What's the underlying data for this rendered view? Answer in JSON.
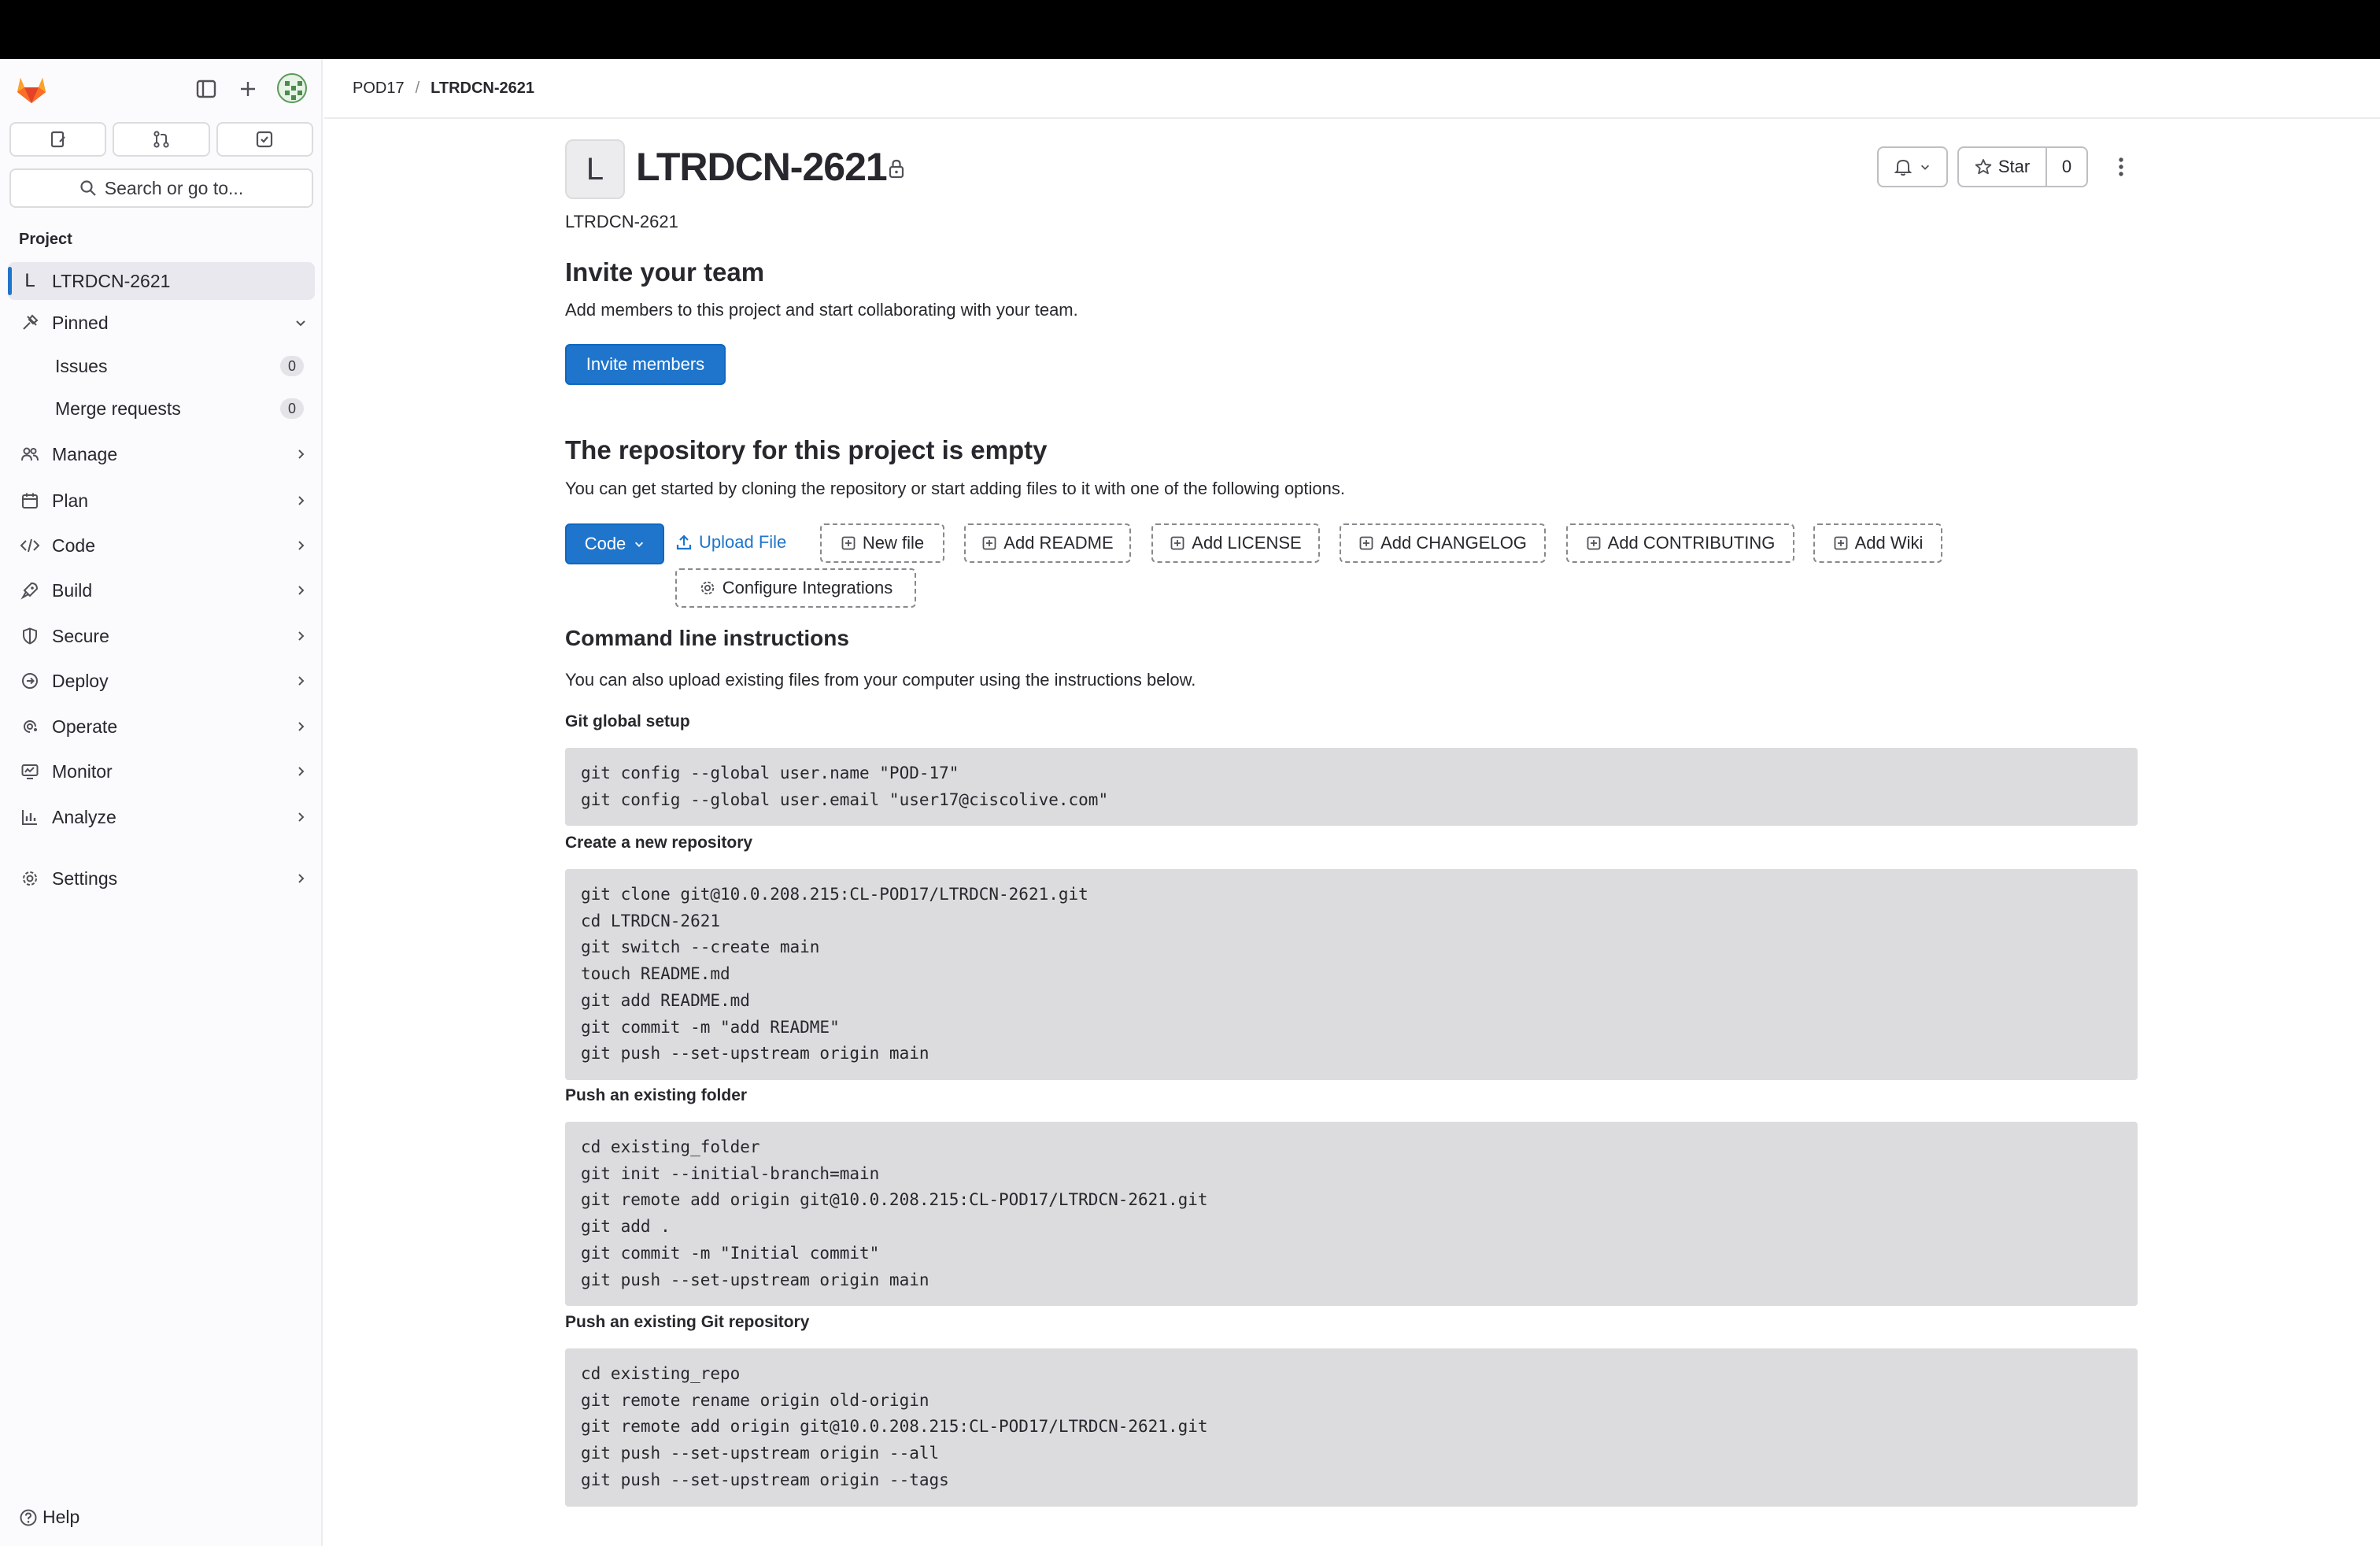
{
  "breadcrumb": {
    "group": "POD17",
    "separator": "/",
    "project": "LTRDCN-2621"
  },
  "sidebar": {
    "search_placeholder": "Search or go to...",
    "section_title": "Project",
    "project": {
      "letter": "L",
      "name": "LTRDCN-2621"
    },
    "pinned": {
      "label": "Pinned",
      "items": [
        {
          "label": "Issues",
          "count": "0"
        },
        {
          "label": "Merge requests",
          "count": "0"
        }
      ]
    },
    "nav": [
      {
        "label": "Manage",
        "icon": "users-icon"
      },
      {
        "label": "Plan",
        "icon": "calendar-icon"
      },
      {
        "label": "Code",
        "icon": "code-icon"
      },
      {
        "label": "Build",
        "icon": "rocket-icon"
      },
      {
        "label": "Secure",
        "icon": "shield-icon"
      },
      {
        "label": "Deploy",
        "icon": "deploy-icon"
      },
      {
        "label": "Operate",
        "icon": "cloud-gear-icon"
      },
      {
        "label": "Monitor",
        "icon": "monitor-icon"
      },
      {
        "label": "Analyze",
        "icon": "chart-icon"
      }
    ],
    "settings": {
      "label": "Settings"
    },
    "help": {
      "label": "Help"
    }
  },
  "project": {
    "avatar_letter": "L",
    "title": "LTRDCN-2621",
    "description": "LTRDCN-2621",
    "star_label": "Star",
    "star_count": "0"
  },
  "invite": {
    "heading": "Invite your team",
    "text": "Add members to this project and start collaborating with your team.",
    "button": "Invite members"
  },
  "empty_repo": {
    "heading": "The repository for this project is empty",
    "text": "You can get started by cloning the repository or start adding files to it with one of the following options.",
    "code_button": "Code",
    "upload_file": "Upload File",
    "actions": [
      "New file",
      "Add README",
      "Add LICENSE",
      "Add CHANGELOG",
      "Add CONTRIBUTING",
      "Add Wiki",
      "Configure Integrations"
    ]
  },
  "cli": {
    "heading": "Command line instructions",
    "text": "You can also upload existing files from your computer using the instructions below.",
    "sections": [
      {
        "title": "Git global setup",
        "lines": [
          "git config --global user.name \"POD-17\"",
          "git config --global user.email \"user17@ciscolive.com\""
        ]
      },
      {
        "title": "Create a new repository",
        "lines": [
          "git clone git@10.0.208.215:CL-POD17/LTRDCN-2621.git",
          "cd LTRDCN-2621",
          "git switch --create main",
          "touch README.md",
          "git add README.md",
          "git commit -m \"add README\"",
          "git push --set-upstream origin main"
        ]
      },
      {
        "title": "Push an existing folder",
        "lines": [
          "cd existing_folder",
          "git init --initial-branch=main",
          "git remote add origin git@10.0.208.215:CL-POD17/LTRDCN-2621.git",
          "git add .",
          "git commit -m \"Initial commit\"",
          "git push --set-upstream origin main"
        ]
      },
      {
        "title": "Push an existing Git repository",
        "lines": [
          "cd existing_repo",
          "git remote rename origin old-origin",
          "git remote add origin git@10.0.208.215:CL-POD17/LTRDCN-2621.git",
          "git push --set-upstream origin --all",
          "git push --set-upstream origin --tags"
        ]
      }
    ]
  },
  "colors": {
    "primary": "#1f75cb",
    "code_bg": "#dcdcde",
    "logo": "#e24329"
  }
}
